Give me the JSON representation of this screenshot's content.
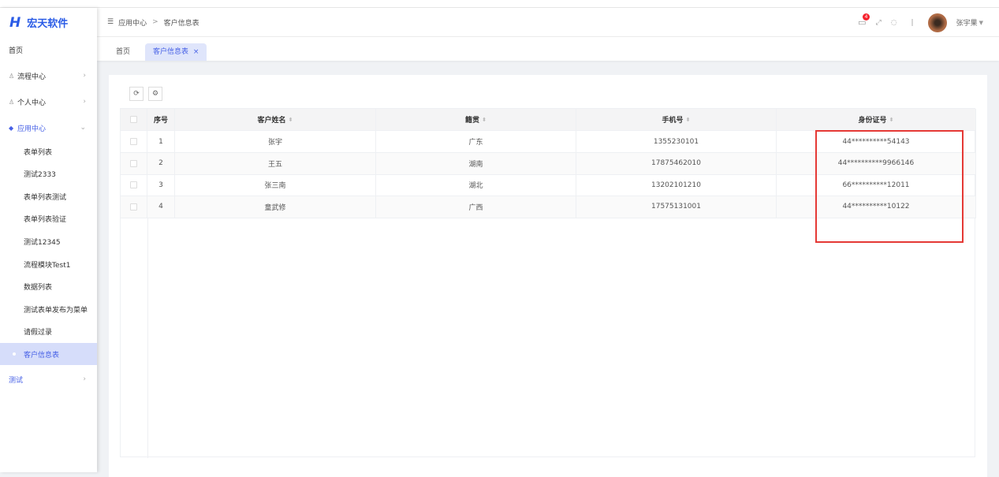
{
  "app": {
    "logo_text": "宏天软件"
  },
  "sidebar": {
    "items": [
      {
        "label": "首页"
      },
      {
        "label": "流程中心",
        "icon": "workflow-icon"
      },
      {
        "label": "个人中心",
        "icon": "user-icon"
      },
      {
        "label": "应用中心",
        "icon": "layers-icon"
      }
    ],
    "sub_items": [
      "表单列表",
      "测试2333",
      "表单列表测试",
      "表单列表验证",
      "测试12345",
      "流程模块Test1",
      "数据列表",
      "测试表单发布为菜单",
      "请假过录",
      "客户信息表"
    ],
    "last": {
      "label": "测试"
    },
    "active": "客户信息表"
  },
  "header": {
    "breadcrumb": [
      "应用中心",
      "客户信息表"
    ],
    "notification_count": "4",
    "user_name": "张宇果"
  },
  "tabs": [
    {
      "label": "首页"
    },
    {
      "label": "客户信息表",
      "close": "×"
    }
  ],
  "table": {
    "columns": [
      "序号",
      "客户姓名",
      "籍贯",
      "手机号",
      "身份证号"
    ],
    "rows": [
      [
        "1",
        "张宇",
        "广东",
        "1355230101",
        "44**********54143"
      ],
      [
        "2",
        "王五",
        "湖南",
        "17875462010",
        "44**********9966146"
      ],
      [
        "3",
        "张三南",
        "湖北",
        "13202101210",
        "66**********12011"
      ],
      [
        "4",
        "童武修",
        "广西",
        "17575131001",
        "44**********10122"
      ]
    ]
  },
  "colors": {
    "accent": "#4660e6",
    "highlight_box": "#e53935"
  }
}
